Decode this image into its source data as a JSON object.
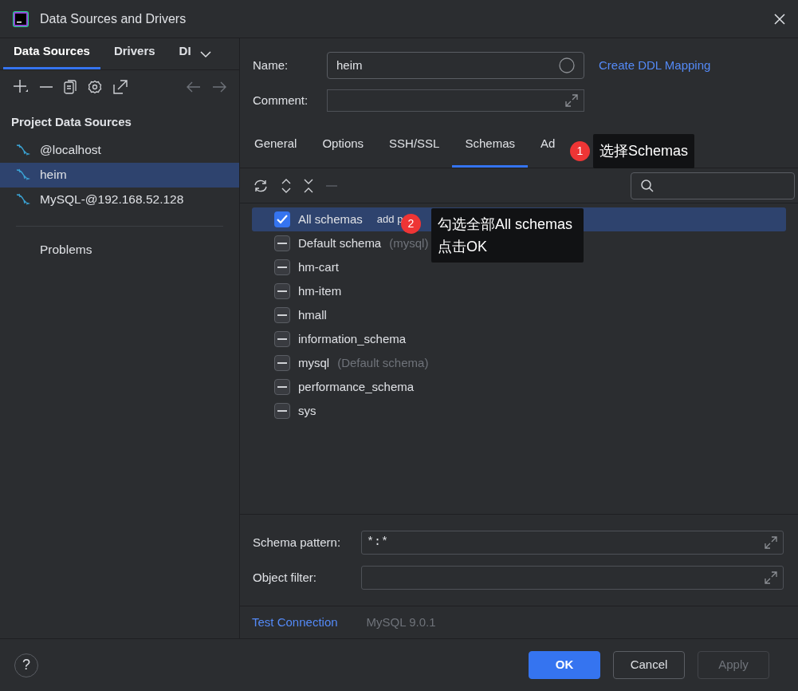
{
  "window": {
    "title": "Data Sources and Drivers"
  },
  "sidebar": {
    "tabs": [
      {
        "label": "Data Sources",
        "selected": true
      },
      {
        "label": "Drivers",
        "selected": false
      },
      {
        "label": "DI",
        "selected": false
      }
    ],
    "section": "Project Data Sources",
    "items": [
      {
        "label": "@localhost",
        "selected": false
      },
      {
        "label": "heim",
        "selected": true
      },
      {
        "label": "MySQL-@192.168.52.128",
        "selected": false
      }
    ],
    "problems": "Problems"
  },
  "form": {
    "name_label": "Name:",
    "name_value": "heim",
    "ddl_link": "Create DDL Mapping",
    "comment_label": "Comment:"
  },
  "tabs": [
    {
      "label": "General",
      "selected": false
    },
    {
      "label": "Options",
      "selected": false
    },
    {
      "label": "SSH/SSL",
      "selected": false
    },
    {
      "label": "Schemas",
      "selected": true
    },
    {
      "label": "Ad",
      "selected": false
    }
  ],
  "schemas": [
    {
      "name": "All schemas",
      "checked": true,
      "selected": true,
      "hint": "add p"
    },
    {
      "name": "Default schema",
      "note": "(mysql)",
      "indeterminate": true,
      "selected": false
    },
    {
      "name": "hm-cart",
      "indeterminate": true,
      "selected": false
    },
    {
      "name": "hm-item",
      "indeterminate": true,
      "selected": false
    },
    {
      "name": "hmall",
      "indeterminate": true,
      "selected": false
    },
    {
      "name": "information_schema",
      "indeterminate": true,
      "selected": false
    },
    {
      "name": "mysql",
      "note": "(Default schema)",
      "indeterminate": true,
      "selected": false
    },
    {
      "name": "performance_schema",
      "indeterminate": true,
      "selected": false
    },
    {
      "name": "sys",
      "indeterminate": true,
      "selected": false
    }
  ],
  "filters": [
    {
      "label": "Schema pattern:",
      "value": "*:*"
    },
    {
      "label": "Object filter:"
    }
  ],
  "status": {
    "link": "Test Connection",
    "version": "MySQL 9.0.1"
  },
  "help": "?",
  "buttons": [
    {
      "label": "OK",
      "kind": "primary"
    },
    {
      "label": "Cancel",
      "kind": "normal"
    },
    {
      "label": "Apply",
      "kind": "disabled"
    }
  ],
  "callouts": [
    {
      "number": "1",
      "text": "选择Schemas"
    },
    {
      "number": "2",
      "text": "勾选全部All schemas\n点击OK"
    }
  ]
}
